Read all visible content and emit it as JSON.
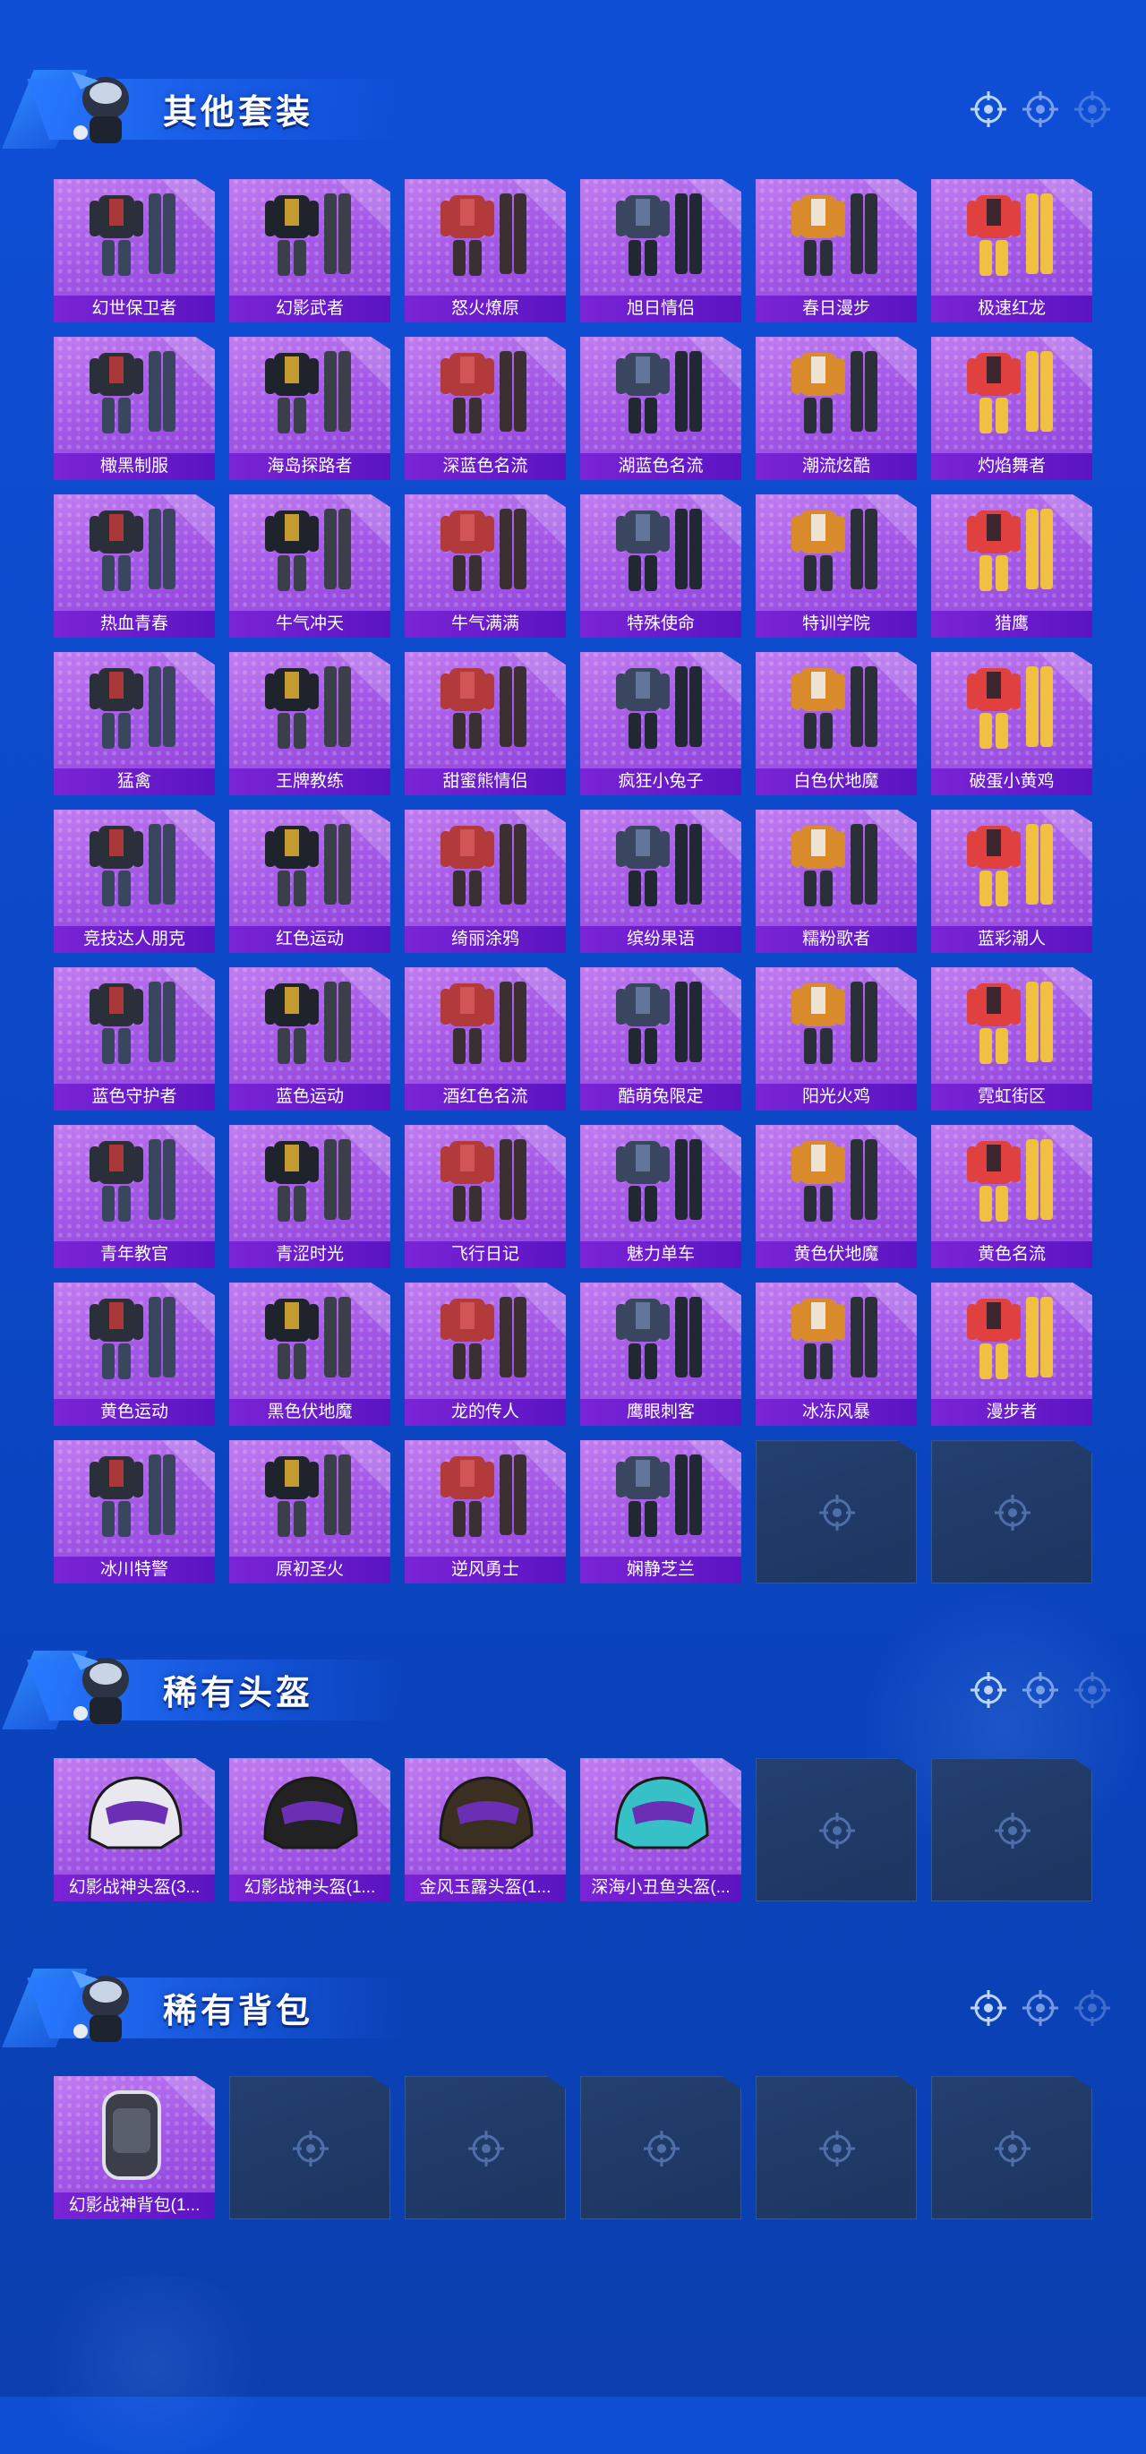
{
  "colors": {
    "background": "#0f4fd6",
    "card_purple": "#a45ae6",
    "label_purple": "#6a1ccc",
    "empty_slot": "#22406e"
  },
  "sections": [
    {
      "title": "其他套装",
      "items": [
        "幻世保卫者",
        "幻影武者",
        "怒火燎原",
        "旭日情侣",
        "春日漫步",
        "极速红龙",
        "橄黑制服",
        "海岛探路者",
        "深蓝色名流",
        "湖蓝色名流",
        "潮流炫酷",
        "灼焰舞者",
        "热血青春",
        "牛气冲天",
        "牛气满满",
        "特殊使命",
        "特训学院",
        "猎鹰",
        "猛禽",
        "王牌教练",
        "甜蜜熊情侣",
        "疯狂小兔子",
        "白色伏地魔",
        "破蛋小黄鸡",
        "竞技达人朋克",
        "红色运动",
        "绮丽涂鸦",
        "缤纷果语",
        "糯粉歌者",
        "蓝彩潮人",
        "蓝色守护者",
        "蓝色运动",
        "酒红色名流",
        "酷萌兔限定",
        "阳光火鸡",
        "霓虹街区",
        "青年教官",
        "青涩时光",
        "飞行日记",
        "魅力单车",
        "黄色伏地魔",
        "黄色名流",
        "黄色运动",
        "黑色伏地魔",
        "龙的传人",
        "鹰眼刺客",
        "冰冻风暴",
        "漫步者",
        "冰川特警",
        "原初圣火",
        "逆风勇士",
        "娴静芝兰"
      ],
      "empty_slots": 2
    },
    {
      "title": "稀有头盔",
      "items": [
        "幻影战神头盔(3...",
        "幻影战神头盔(1...",
        "金风玉露头盔(1...",
        "深海小丑鱼头盔(..."
      ],
      "empty_slots": 2
    },
    {
      "title": "稀有背包",
      "items": [
        "幻影战神背包(1..."
      ],
      "empty_slots": 5
    }
  ]
}
